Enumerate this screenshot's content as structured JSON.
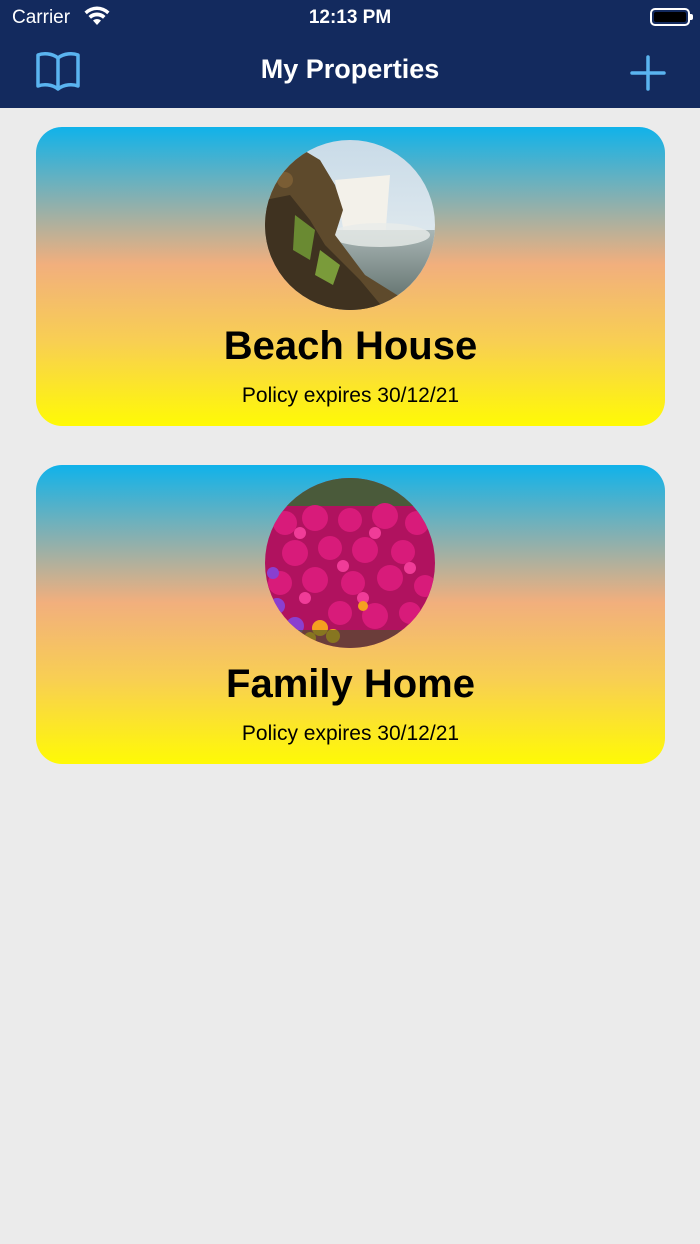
{
  "status_bar": {
    "carrier": "Carrier",
    "time": "12:13 PM"
  },
  "nav": {
    "title": "My Properties",
    "left_icon": "book-icon",
    "right_icon": "plus-icon",
    "accent_color": "#5ab4f0",
    "bar_color": "#132a5e"
  },
  "properties": [
    {
      "name": "Beach House",
      "policy": "Policy expires 30/12/21",
      "image": "waterfall-photo"
    },
    {
      "name": "Family Home",
      "policy": "Policy expires 30/12/21",
      "image": "flowers-photo"
    }
  ],
  "card_gradient": [
    "#10b2ea",
    "#f2af7d",
    "#f8cf52",
    "#fffa05"
  ]
}
